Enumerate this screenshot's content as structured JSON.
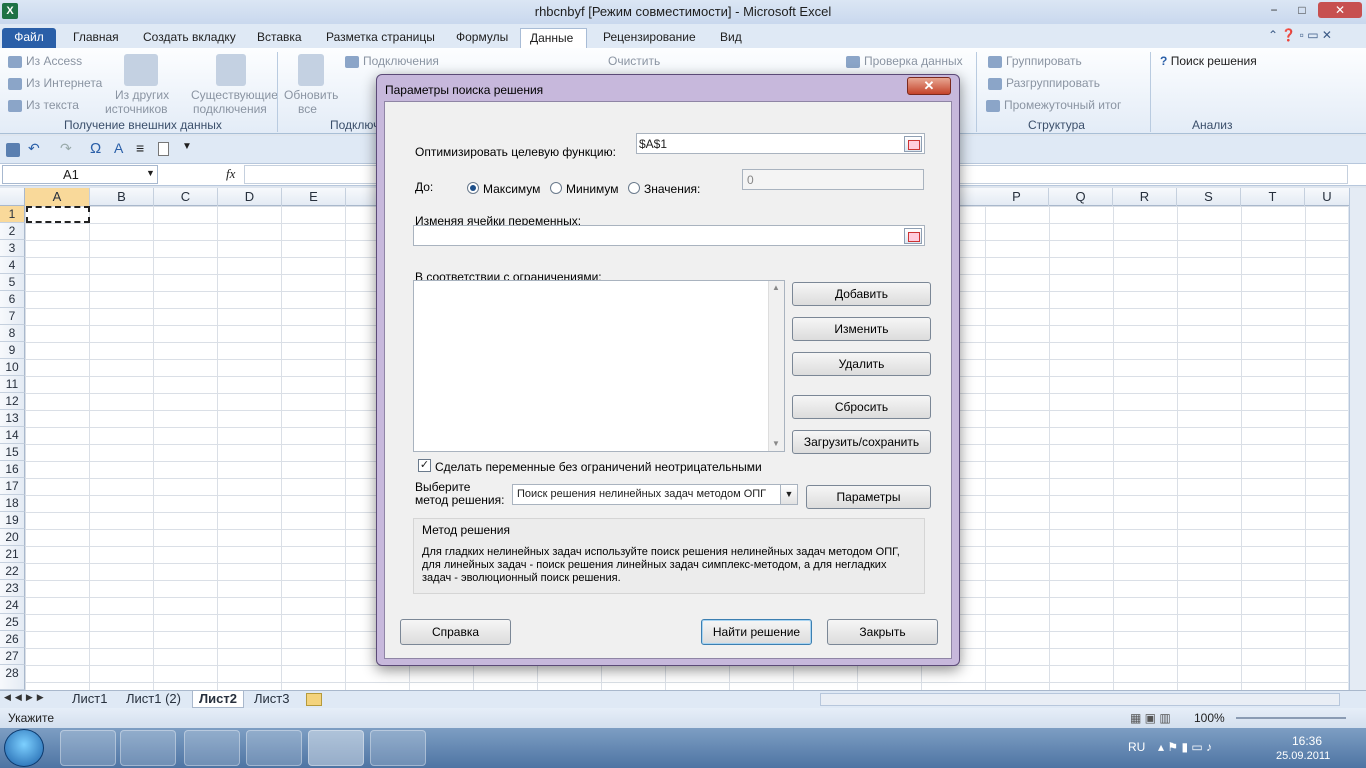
{
  "window": {
    "title": "rhbcnbyf  [Режим совместимости]  -  Microsoft Excel",
    "min": "−",
    "max": "□",
    "close": "✕"
  },
  "ribbon": {
    "tabs": [
      "Файл",
      "Главная",
      "Создать вкладку",
      "Вставка",
      "Разметка страницы",
      "Формулы",
      "Данные",
      "Рецензирование",
      "Вид"
    ],
    "active_tab": "Данные",
    "external": {
      "access": "Из Access",
      "web": "Из Интернета",
      "text": "Из текста",
      "other": "Из других",
      "other2": "источников",
      "existing": "Существующие",
      "existing2": "подключения",
      "group": "Получение внешних данных"
    },
    "connections": {
      "refresh": "Обновить",
      "refresh2": "все",
      "conn": "Подключения",
      "group": "Подключ"
    },
    "sort": {
      "clear": "Очистить"
    },
    "tools": {
      "validate": "Проверка данных"
    },
    "outline": {
      "group_btn": "Группировать",
      "ungroup_btn": "Разгруппировать",
      "subtotal": "Промежуточный итог",
      "group": "Структура"
    },
    "analysis": {
      "solver": "Поиск решения",
      "group": "Анализ"
    }
  },
  "formula_bar": {
    "name_box": "A1",
    "fx": "fx",
    "formula": ""
  },
  "grid": {
    "columns_left": [
      "A",
      "B",
      "C",
      "D",
      "E"
    ],
    "columns_right": [
      "P",
      "Q",
      "R",
      "S",
      "T",
      "U"
    ],
    "rows": [
      "1",
      "2",
      "3",
      "4",
      "5",
      "6",
      "7",
      "8",
      "9",
      "10",
      "11",
      "12",
      "13",
      "14",
      "15",
      "16",
      "17",
      "18",
      "19",
      "20",
      "21",
      "22",
      "23",
      "24",
      "25",
      "26",
      "27",
      "28"
    ]
  },
  "sheets": {
    "tabs": [
      "Лист1",
      "Лист1 (2)",
      "Лист2",
      "Лист3"
    ],
    "active": "Лист2"
  },
  "status": {
    "mode": "Укажите",
    "zoom": "100%"
  },
  "taskbar": {
    "lang": "RU",
    "time": "16:36",
    "date": "25.09.2011"
  },
  "dialog": {
    "title": "Параметры поиска решения",
    "objective_label": "Оптимизировать целевую функцию:",
    "objective_value": "$A$1",
    "to_label": "До:",
    "opt_max": "Максимум",
    "opt_min": "Минимум",
    "opt_value": "Значения:",
    "value_field": "0",
    "variables_label": "Изменяя ячейки переменных:",
    "variables_value": "",
    "constraints_label": "В соответствии с ограничениями:",
    "btn_add": "Добавить",
    "btn_change": "Изменить",
    "btn_delete": "Удалить",
    "btn_reset": "Сбросить",
    "btn_load": "Загрузить/сохранить",
    "nonneg_label": "Сделать переменные без ограничений неотрицательными",
    "nonneg_checked": true,
    "method_label1": "Выберите",
    "method_label2": "метод решения:",
    "method_value": "Поиск решения нелинейных задач методом ОПГ",
    "btn_options": "Параметры",
    "method_box_title": "Метод решения",
    "method_desc": "Для гладких нелинейных задач используйте поиск решения нелинейных задач методом ОПГ, для линейных задач - поиск решения линейных задач симплекс-методом, а для негладких задач - эволюционный поиск решения.",
    "btn_help": "Справка",
    "btn_solve": "Найти решение",
    "btn_close": "Закрыть"
  }
}
